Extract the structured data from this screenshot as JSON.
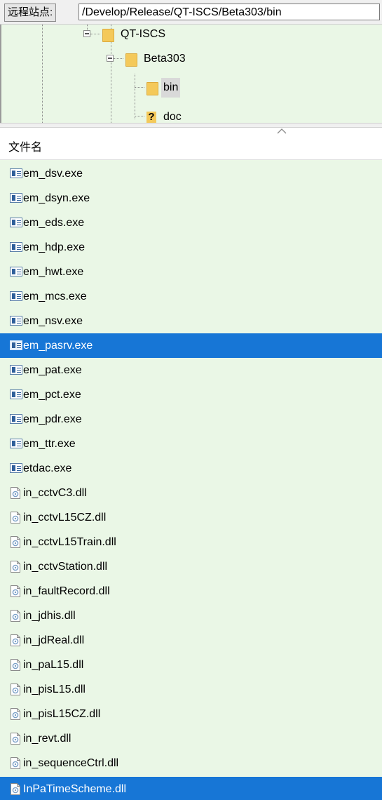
{
  "remote": {
    "label": "远程站点:",
    "path": "/Develop/Release/QT-ISCS/Beta303/bin"
  },
  "tree": {
    "nodes": [
      {
        "label": "QT-ISCS",
        "expanded": true,
        "icon": "folder-icon"
      },
      {
        "label": "Beta303",
        "expanded": true,
        "icon": "folder-icon"
      },
      {
        "label": "bin",
        "selected": true,
        "icon": "folder-icon"
      },
      {
        "label": "doc",
        "icon": "unknown-folder-icon"
      }
    ]
  },
  "list": {
    "header": "文件名",
    "sort_direction": "ascending",
    "files": [
      {
        "name": "em_dsv.exe",
        "icon": "exe-icon"
      },
      {
        "name": "em_dsyn.exe",
        "icon": "exe-icon"
      },
      {
        "name": "em_eds.exe",
        "icon": "exe-icon"
      },
      {
        "name": "em_hdp.exe",
        "icon": "exe-icon"
      },
      {
        "name": "em_hwt.exe",
        "icon": "exe-icon"
      },
      {
        "name": "em_mcs.exe",
        "icon": "exe-icon"
      },
      {
        "name": "em_nsv.exe",
        "icon": "exe-icon"
      },
      {
        "name": "em_pasrv.exe",
        "icon": "exe-icon",
        "selected": true
      },
      {
        "name": "em_pat.exe",
        "icon": "exe-icon"
      },
      {
        "name": "em_pct.exe",
        "icon": "exe-icon"
      },
      {
        "name": "em_pdr.exe",
        "icon": "exe-icon"
      },
      {
        "name": "em_ttr.exe",
        "icon": "exe-icon"
      },
      {
        "name": "etdac.exe",
        "icon": "exe-icon"
      },
      {
        "name": "in_cctvC3.dll",
        "icon": "dll-icon"
      },
      {
        "name": "in_cctvL15CZ.dll",
        "icon": "dll-icon"
      },
      {
        "name": "in_cctvL15Train.dll",
        "icon": "dll-icon"
      },
      {
        "name": "in_cctvStation.dll",
        "icon": "dll-icon"
      },
      {
        "name": "in_faultRecord.dll",
        "icon": "dll-icon"
      },
      {
        "name": "in_jdhis.dll",
        "icon": "dll-icon"
      },
      {
        "name": "in_jdReal.dll",
        "icon": "dll-icon"
      },
      {
        "name": "in_paL15.dll",
        "icon": "dll-icon"
      },
      {
        "name": "in_pisL15.dll",
        "icon": "dll-icon"
      },
      {
        "name": "in_pisL15CZ.dll",
        "icon": "dll-icon"
      },
      {
        "name": "in_revt.dll",
        "icon": "dll-icon"
      },
      {
        "name": "in_sequenceCtrl.dll",
        "icon": "dll-icon"
      },
      {
        "name": "InPaTimeScheme.dll",
        "icon": "dll-icon",
        "selected": true
      }
    ]
  },
  "colors": {
    "list_background": "#eaf7e6",
    "selection": "#1776d6",
    "folder": "#f4c95a"
  }
}
